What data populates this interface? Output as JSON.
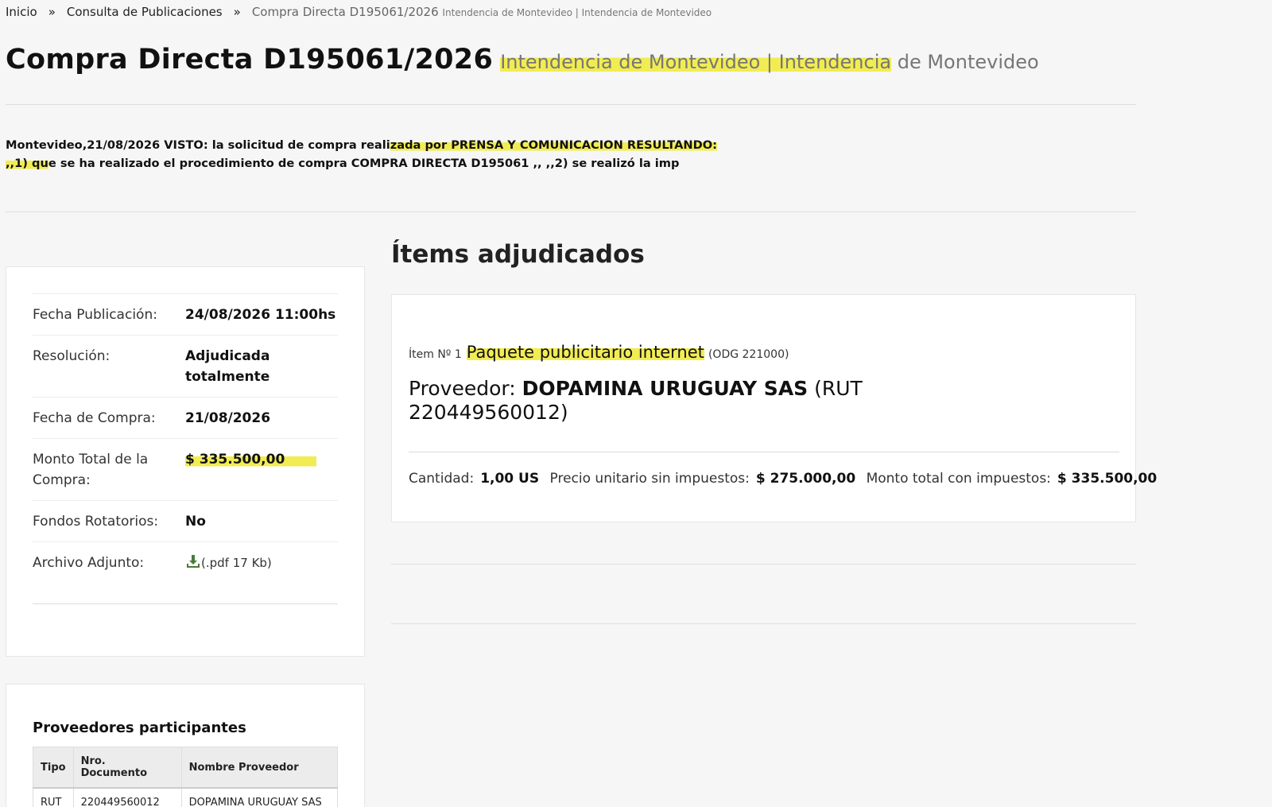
{
  "breadcrumb": {
    "home": "Inicio",
    "sep1": "»",
    "section": "Consulta de Publicaciones",
    "sep2": "»",
    "current": "Compra Directa D195061/2026",
    "current_org": "Intendencia de Montevideo | Intendencia de Montevideo"
  },
  "title": {
    "main": "Compra Directa D195061/2026",
    "org_highlighted": "Intendencia de Montevideo | Intendencia",
    "org_rest": " de Montevideo"
  },
  "description": {
    "pre": "Montevideo,21/08/2026 VISTO: la solicitud de compra reali",
    "highlighted": "zada por PRENSA Y COMUNICACION RESULTANDO: ,,1) qu",
    "post": "e se ha realizado el procedimiento de compra COMPRA DIRECTA D195061 ,, ,,2) se realizó la imp"
  },
  "info": {
    "rows": [
      {
        "label": "Fecha Publicación:",
        "value": "24/08/2026 11:00hs"
      },
      {
        "label": "Resolución:",
        "value": "Adjudicada totalmente"
      },
      {
        "label": "Fecha de Compra:",
        "value": "21/08/2026"
      },
      {
        "label": "Monto Total de la Compra:",
        "value": "$ 335.500,00"
      },
      {
        "label": "Fondos Rotatorios:",
        "value": "No"
      },
      {
        "label": "Archivo Adjunto:",
        "value": "(.pdf 17 Kb)"
      }
    ]
  },
  "items": {
    "title": "Ítems adjudicados",
    "item": {
      "number_label": "Ítem Nº 1",
      "name": "Paquete publicitario internet",
      "odg": "(ODG 221000)",
      "provider_label": "Proveedor:",
      "provider_name": "DOPAMINA URUGUAY SAS",
      "provider_rut": "(RUT 220449560012)",
      "cantidad_label": "Cantidad:",
      "cantidad": "1,00 US",
      "precio_label": "Precio unitario sin impuestos:",
      "precio": "$ 275.000,00",
      "monto_label": "Monto total con impuestos:",
      "monto": "$ 335.500,00"
    }
  },
  "proveedores": {
    "title": "Proveedores participantes",
    "headers": [
      "Tipo",
      "Nro. Documento",
      "Nombre Proveedor"
    ],
    "rows": [
      [
        "RUT",
        "220449560012",
        "DOPAMINA URUGUAY SAS"
      ]
    ]
  },
  "colors": {
    "highlight": "#f2ec53",
    "download_icon": "#4a7a3a"
  },
  "icons": {
    "download": "download-icon"
  }
}
